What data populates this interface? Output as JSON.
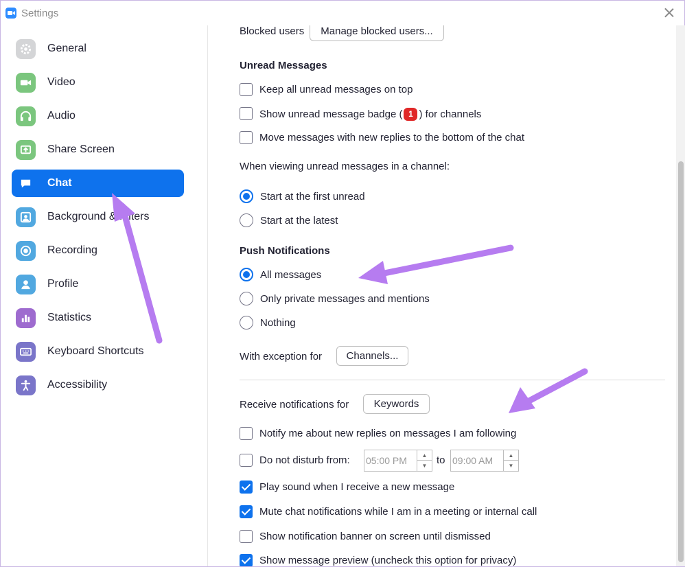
{
  "window": {
    "title": "Settings"
  },
  "sidebar": {
    "items": [
      {
        "label": "General",
        "icon": "gear-icon",
        "color": "#cfd0d2"
      },
      {
        "label": "Video",
        "icon": "video-camera-icon",
        "color": "#7bc67e"
      },
      {
        "label": "Audio",
        "icon": "headphones-icon",
        "color": "#7bc67e"
      },
      {
        "label": "Share Screen",
        "icon": "share-screen-icon",
        "color": "#7bc67e"
      },
      {
        "label": "Chat",
        "icon": "chat-bubble-icon",
        "color": "#0e72ed",
        "active": true
      },
      {
        "label": "Background & Filters",
        "icon": "background-person-icon",
        "color": "#51a8e0"
      },
      {
        "label": "Recording",
        "icon": "record-icon",
        "color": "#51a8e0"
      },
      {
        "label": "Profile",
        "icon": "profile-icon",
        "color": "#51a8e0"
      },
      {
        "label": "Statistics",
        "icon": "bar-chart-icon",
        "color": "#9e6bcf"
      },
      {
        "label": "Keyboard Shortcuts",
        "icon": "keyboard-icon",
        "color": "#7a75c9"
      },
      {
        "label": "Accessibility",
        "icon": "accessibility-icon",
        "color": "#7a75c9"
      }
    ]
  },
  "main": {
    "blocked_users_label": "Blocked users",
    "manage_blocked_button": "Manage blocked users...",
    "unread_heading": "Unread Messages",
    "unread_options": [
      {
        "label": "Keep all unread messages on top",
        "checked": false
      },
      {
        "label_before": "Show unread message badge (",
        "badge": "1",
        "label_after": ") for channels",
        "checked": false
      },
      {
        "label": "Move messages with new replies to the bottom of the chat",
        "checked": false
      }
    ],
    "viewing_label": "When viewing unread messages in a channel:",
    "viewing_options": [
      {
        "label": "Start at the first unread",
        "checked": true
      },
      {
        "label": "Start at the latest",
        "checked": false
      }
    ],
    "push_heading": "Push Notifications",
    "push_options": [
      {
        "label": "All messages",
        "checked": true
      },
      {
        "label": "Only private messages and mentions",
        "checked": false
      },
      {
        "label": "Nothing",
        "checked": false
      }
    ],
    "exception_label": "With exception for",
    "channels_button": "Channels...",
    "receive_label": "Receive notifications for",
    "keywords_button": "Keywords",
    "notify_replies_label": "Notify me about new replies on messages I am following",
    "notify_replies_checked": false,
    "dnd": {
      "label": "Do not disturb from:",
      "checked": false,
      "from_value": "05:00 PM",
      "to_label": "to",
      "to_value": "09:00 AM"
    },
    "more_options": [
      {
        "label": "Play sound when I receive a new message",
        "checked": true
      },
      {
        "label": "Mute chat notifications while I am in a meeting or internal call",
        "checked": true
      },
      {
        "label": "Show notification banner on screen until dismissed",
        "checked": false
      },
      {
        "label": "Show message preview (uncheck this option for privacy)",
        "checked": true
      }
    ]
  },
  "annotation_color": "#b67cf0"
}
